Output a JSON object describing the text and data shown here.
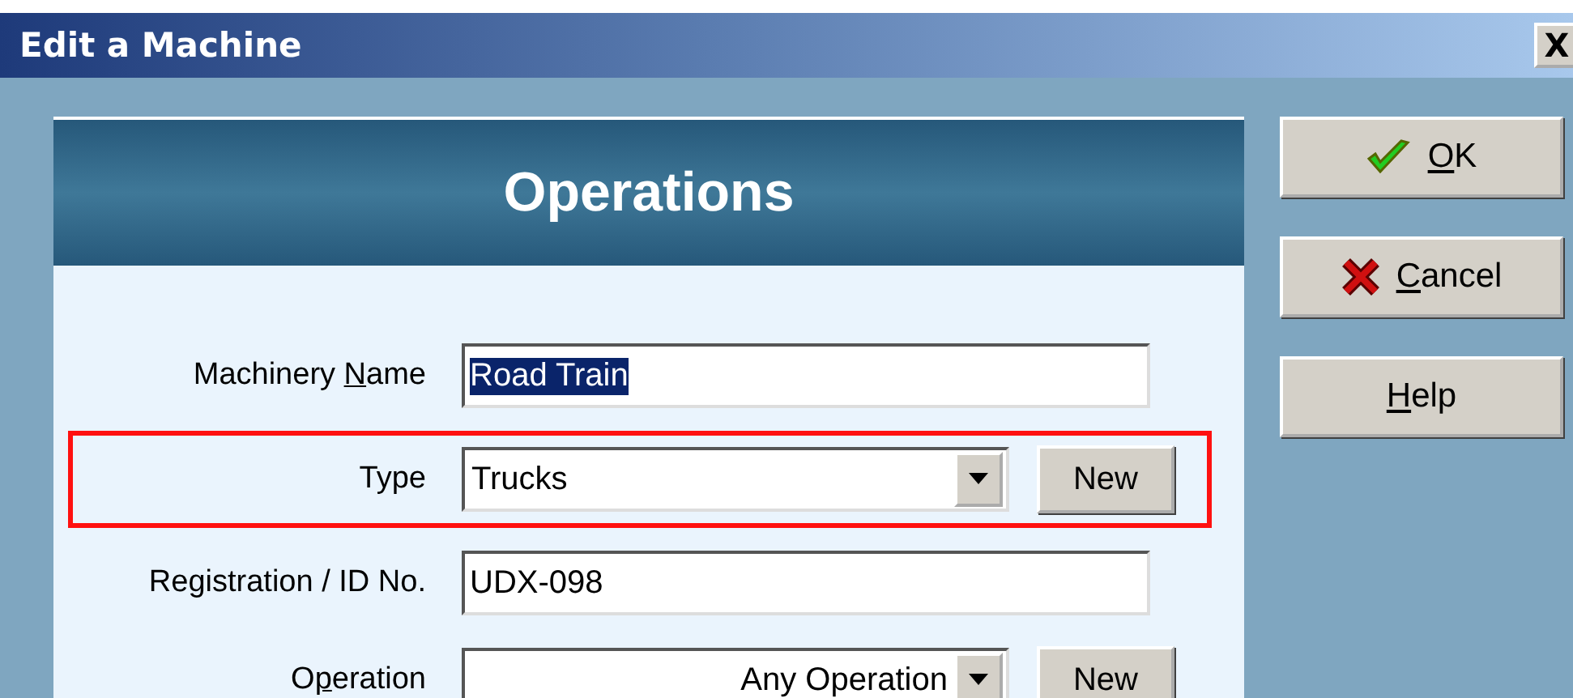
{
  "window": {
    "title": "Edit a Machine",
    "close": "X"
  },
  "panel": {
    "title": "Operations"
  },
  "fields": [
    {
      "kind": "text",
      "label": {
        "pre": "Machinery ",
        "key": "N",
        "post": "ame"
      },
      "value": "Road Train",
      "selected_text": true,
      "highlighted": false
    },
    {
      "kind": "dropdown",
      "label": {
        "pre": "Type"
      },
      "value": "Trucks",
      "button": "New",
      "highlighted": true
    },
    {
      "kind": "text",
      "label": {
        "pre": "Registration / ID No."
      },
      "value": "UDX-098",
      "selected_text": false,
      "highlighted": false
    },
    {
      "kind": "filter",
      "label": {
        "pre": "O",
        "key": "p",
        "post": "eration"
      },
      "value": "Any Operation",
      "button": "New",
      "highlighted": false
    }
  ],
  "buttons": [
    {
      "kind": "ok",
      "label": {
        "key": "O",
        "post": "K"
      }
    },
    {
      "kind": "cancel",
      "label": {
        "key": "C",
        "post": "ancel"
      }
    },
    {
      "kind": "help",
      "label": {
        "key": "H",
        "post": "elp"
      }
    }
  ]
}
